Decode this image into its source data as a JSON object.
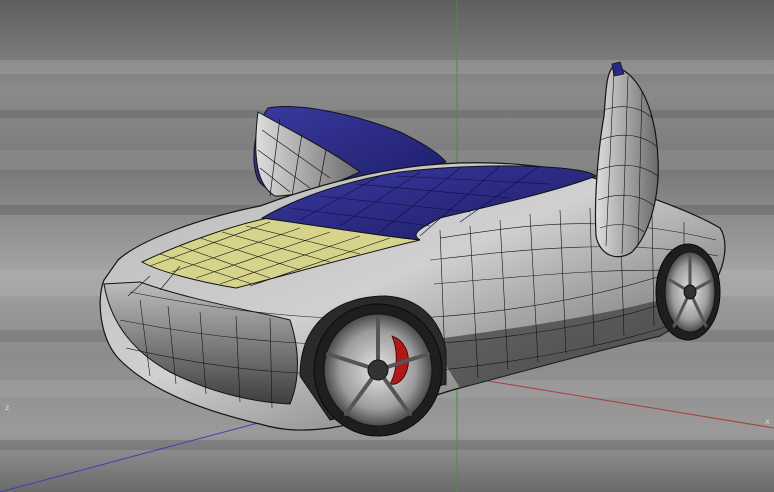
{
  "viewport": {
    "axes": {
      "x_label": "x",
      "z_label": "z",
      "x_color": "#b23a3a",
      "y_color": "#2f9e3a",
      "z_color": "#3a3fb2"
    },
    "colors": {
      "background": "#6f6f6f",
      "body_light": "#c4c4c4",
      "body_dark": "#3a3a3a",
      "wire": "#141414",
      "hood_selected": "#d6d48a",
      "glass_blue": "#2a2a86",
      "brake_caliper": "#b01818"
    },
    "model": {
      "icon": "sports-car-wireframe-icon"
    }
  }
}
